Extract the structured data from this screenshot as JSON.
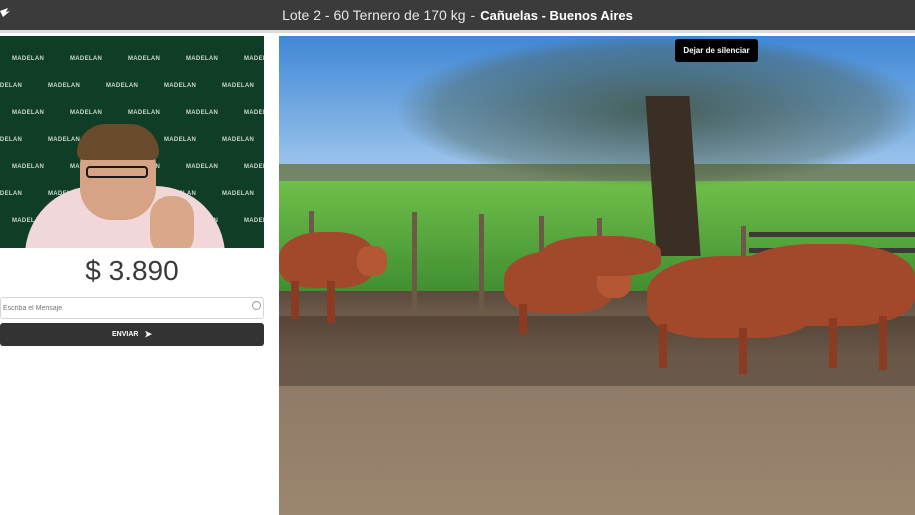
{
  "header": {
    "title": "Lote 2 - 60 Ternero de 170 kg",
    "separator": "-",
    "location": "Cañuelas - Buenos Aires"
  },
  "webcam": {
    "backdrop_brand": "MADELAN"
  },
  "bidding": {
    "price": "$ 3.890",
    "message_placeholder": "Escriba el Mensaje",
    "send_label": "ENVIAR",
    "send_icon": "➤"
  },
  "video": {
    "unmute_label": "Dejar de silenciar"
  },
  "colors": {
    "topbar": "#3b3b3b",
    "button": "#333333",
    "backdrop": "#0f3d25"
  }
}
